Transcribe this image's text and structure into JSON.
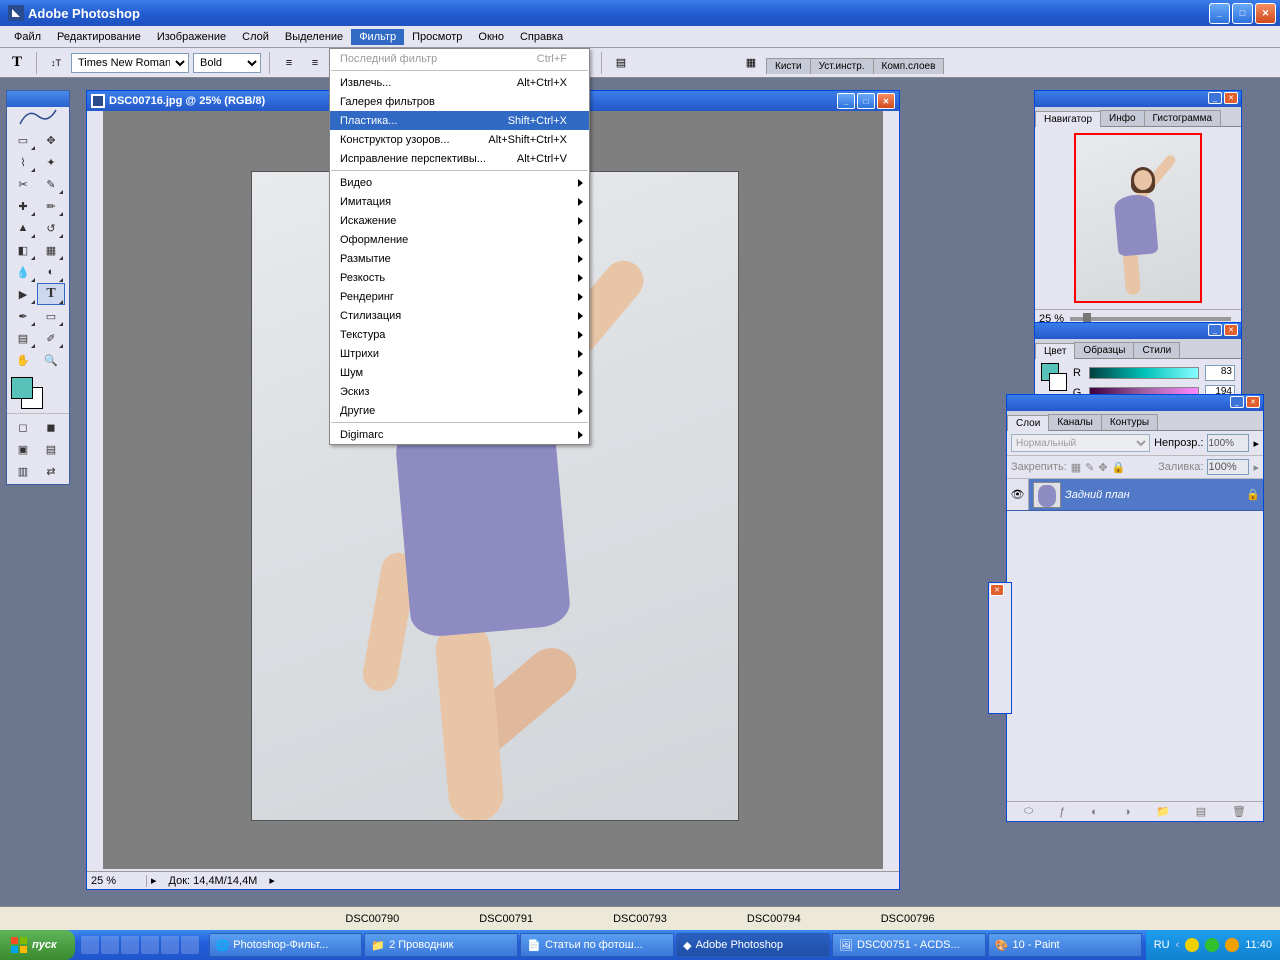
{
  "app_title": "Adobe Photoshop",
  "menu": [
    "Файл",
    "Редактирование",
    "Изображение",
    "Слой",
    "Выделение",
    "Фильтр",
    "Просмотр",
    "Окно",
    "Справка"
  ],
  "menu_active_index": 5,
  "options": {
    "font": "Times New Roman",
    "weight": "Bold",
    "swatch_color": "#58c1b9",
    "presets": [
      "Кисти",
      "Уст.инстр.",
      "Комп.слоев"
    ]
  },
  "filter_menu": [
    {
      "label": "Последний фильтр",
      "shortcut": "Ctrl+F",
      "disabled": true
    },
    {
      "sep": true
    },
    {
      "label": "Извлечь...",
      "shortcut": "Alt+Ctrl+X"
    },
    {
      "label": "Галерея фильтров"
    },
    {
      "label": "Пластика...",
      "shortcut": "Shift+Ctrl+X",
      "hl": true
    },
    {
      "label": "Конструктор узоров...",
      "shortcut": "Alt+Shift+Ctrl+X"
    },
    {
      "label": "Исправление перспективы...",
      "shortcut": "Alt+Ctrl+V"
    },
    {
      "sep": true
    },
    {
      "label": "Видео",
      "sub": true
    },
    {
      "label": "Имитация",
      "sub": true
    },
    {
      "label": "Искажение",
      "sub": true
    },
    {
      "label": "Оформление",
      "sub": true
    },
    {
      "label": "Размытие",
      "sub": true
    },
    {
      "label": "Резкость",
      "sub": true
    },
    {
      "label": "Рендеринг",
      "sub": true
    },
    {
      "label": "Стилизация",
      "sub": true
    },
    {
      "label": "Текстура",
      "sub": true
    },
    {
      "label": "Штрихи",
      "sub": true
    },
    {
      "label": "Шум",
      "sub": true
    },
    {
      "label": "Эскиз",
      "sub": true
    },
    {
      "label": "Другие",
      "sub": true
    },
    {
      "sep": true
    },
    {
      "label": "Digimarc",
      "sub": true
    }
  ],
  "document": {
    "title": "DSC00716.jpg @ 25% (RGB/8)",
    "zoom": "25 %",
    "size": "Док: 14,4M/14,4M"
  },
  "navigator": {
    "tabs": [
      "Навигатор",
      "Инфо",
      "Гистограмма"
    ],
    "zoom": "25 %"
  },
  "color": {
    "tabs": [
      "Цвет",
      "Образцы",
      "Стили"
    ],
    "r_label": "R",
    "r_val": "83",
    "g_label": "G",
    "g_val": "194"
  },
  "layers": {
    "tabs": [
      "Слои",
      "Каналы",
      "Контуры"
    ],
    "blend": "Нормальный",
    "opacity_label": "Непрозр.:",
    "opacity": "100%",
    "lock_label": "Закрепить:",
    "fill_label": "Заливка:",
    "fill": "100%",
    "layer_name": "Задний план"
  },
  "file_tabs": [
    "DSC00790",
    "DSC00791",
    "DSC00793",
    "DSC00794",
    "DSC00796"
  ],
  "taskbar": {
    "start": "пуск",
    "tasks": [
      "Photoshop-Фильт...",
      "2 Проводник",
      "Статьи по фотош...",
      "Adobe Photoshop",
      "DSC00751 - ACDS...",
      "10 - Paint"
    ],
    "lang": "RU",
    "clock": "11:40"
  }
}
